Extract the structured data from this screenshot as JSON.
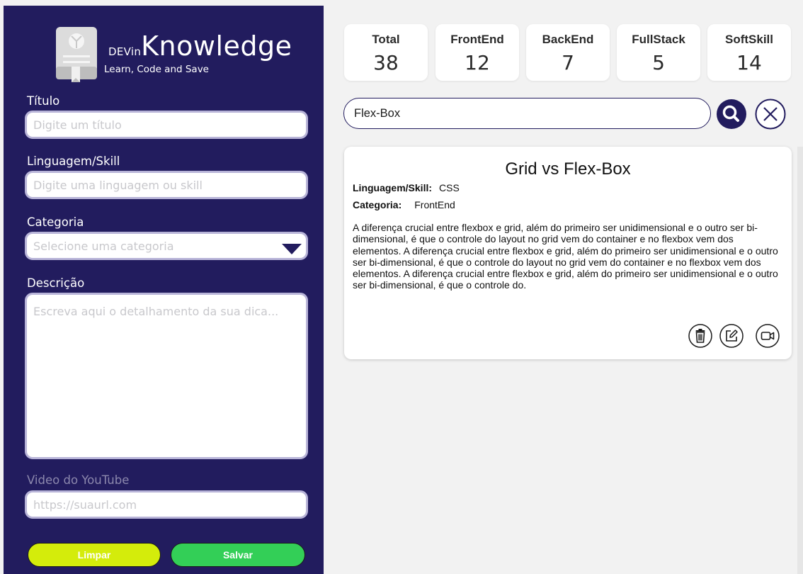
{
  "brand": {
    "prefix": "DEVin",
    "name": "Knowledge",
    "tagline": "Learn, Code and Save"
  },
  "form": {
    "title": {
      "label": "Título",
      "placeholder": "Digite um título",
      "value": ""
    },
    "skill": {
      "label": "Linguagem/Skill",
      "placeholder": "Digite uma linguagem ou skill",
      "value": ""
    },
    "category": {
      "label": "Categoria",
      "placeholder": "Selecione uma categoria",
      "value": ""
    },
    "description": {
      "label": "Descrição",
      "placeholder": "Escreva aqui o detalhamento da sua dica...",
      "value": ""
    },
    "video": {
      "label": "Video do YouTube",
      "placeholder": "https://suaurl.com",
      "value": ""
    },
    "clear_label": "Limpar",
    "save_label": "Salvar"
  },
  "stats": [
    {
      "label": "Total",
      "value": "38"
    },
    {
      "label": "FrontEnd",
      "value": "12"
    },
    {
      "label": "BackEnd",
      "value": "7"
    },
    {
      "label": "FullStack",
      "value": "5"
    },
    {
      "label": "SoftSkill",
      "value": "14"
    }
  ],
  "search": {
    "value": "Flex-Box"
  },
  "cards": [
    {
      "title": "Grid vs Flex-Box",
      "skill_label": "Linguagem/Skill:",
      "skill": "CSS",
      "category_label": "Categoria:",
      "category": "FrontEnd",
      "description": "A diferença crucial entre flexbox e grid, além do primeiro ser unidimensional e o outro ser bi-dimensional, é que o controle do layout no grid vem do container e no flexbox vem dos elementos. A diferença crucial entre flexbox e grid, além do primeiro ser unidimensional e o outro ser bi-dimensional, é que o controle do layout no grid vem do container e no flexbox vem dos elementos. A diferença crucial entre flexbox e grid, além do primeiro ser unidimensional e o outro ser bi-dimensional, é que o controle do."
    }
  ],
  "colors": {
    "sidebar": "#221c5e",
    "clear_button": "#d4ec0b",
    "save_button": "#33cf57"
  },
  "icons": [
    "book-icon",
    "caret-down-icon",
    "search-icon",
    "close-icon",
    "trash-icon",
    "edit-icon",
    "video-icon"
  ]
}
